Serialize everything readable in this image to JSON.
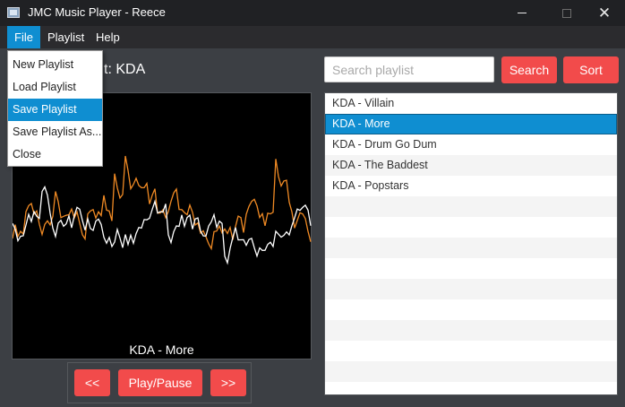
{
  "window": {
    "title": "JMC Music Player - Reece"
  },
  "menu": {
    "file": "File",
    "playlist": "Playlist",
    "help": "Help",
    "file_items": [
      "New Playlist",
      "Load Playlist",
      "Save Playlist",
      "Save Playlist As...",
      "Close"
    ]
  },
  "header": {
    "playlist_label": "t:  KDA"
  },
  "player": {
    "now_playing": "KDA - More",
    "prev_label": "<<",
    "play_label": "Play/Pause",
    "next_label": ">>"
  },
  "search": {
    "placeholder": "Search playlist",
    "search_label": "Search",
    "sort_label": "Sort"
  },
  "playlist": {
    "items": [
      "KDA - Villain",
      "KDA - More",
      "KDA - Drum Go Dum",
      "KDA - The Baddest",
      "KDA - Popstars"
    ]
  },
  "colors": {
    "accent": "#f24b4b",
    "selection": "#0f8ed1",
    "waveform_primary": "#ffffff",
    "waveform_secondary": "#f08a24"
  }
}
